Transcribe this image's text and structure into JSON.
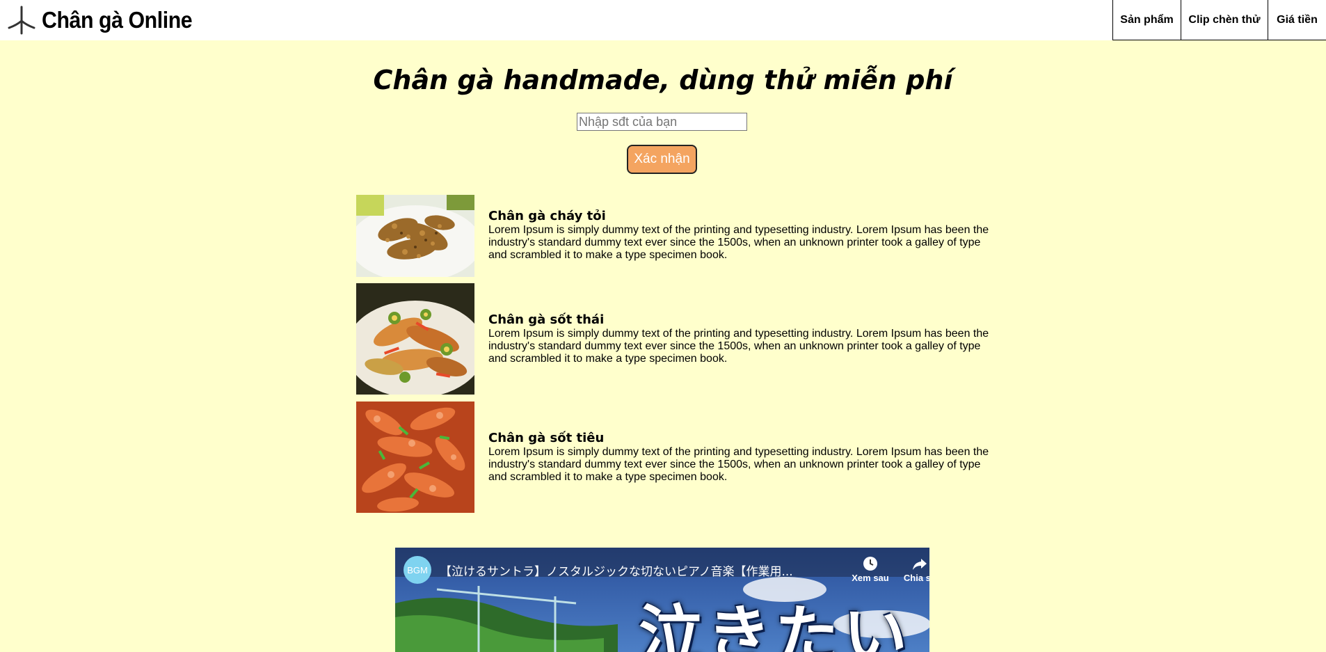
{
  "header": {
    "brand": "Chân gà Online",
    "logo_icon": "chicken-foot-icon",
    "nav": [
      "Sản phẩm",
      "Clip chèn thử",
      "Giá tiền"
    ]
  },
  "hero": {
    "title": "Chân gà handmade, dùng thử miễn phí",
    "phone_placeholder": "Nhập sđt của bạn",
    "phone_value": "",
    "submit_label": "Xác nhận",
    "submit_color": "#F4A460"
  },
  "products": [
    {
      "name": "Chân gà cháy tỏi",
      "desc": "Lorem Ipsum is simply dummy text of the printing and typesetting industry. Lorem Ipsum has been the industry's standard dummy text ever since the 1500s, when an unknown printer took a galley of type and scrambled it to make a type specimen book.",
      "image": "garlic-fried-chicken-feet-photo"
    },
    {
      "name": "Chân gà sốt thái",
      "desc": "Lorem Ipsum is simply dummy text of the printing and typesetting industry. Lorem Ipsum has been the industry's standard dummy text ever since the 1500s, when an unknown printer took a galley of type and scrambled it to make a type specimen book.",
      "image": "thai-sauce-chicken-feet-photo"
    },
    {
      "name": "Chân gà sốt tiêu",
      "desc": "Lorem Ipsum is simply dummy text of the printing and typesetting industry. Lorem Ipsum has been the industry's standard dummy text ever since the 1500s, when an unknown printer took a galley of type and scrambled it to make a type specimen book.",
      "image": "pepper-sauce-chicken-feet-photo"
    }
  ],
  "video": {
    "channel_badge": "BGM",
    "title": "【泣けるサントラ】ノスタルジックな切ないピアノ音楽【作業用...",
    "watch_later": "Xem sau",
    "share": "Chia sẻ",
    "thumbnail_text": "泣きたい"
  },
  "colors": {
    "page_background": "#FFFFCC",
    "header_background": "#FFFFFF"
  }
}
